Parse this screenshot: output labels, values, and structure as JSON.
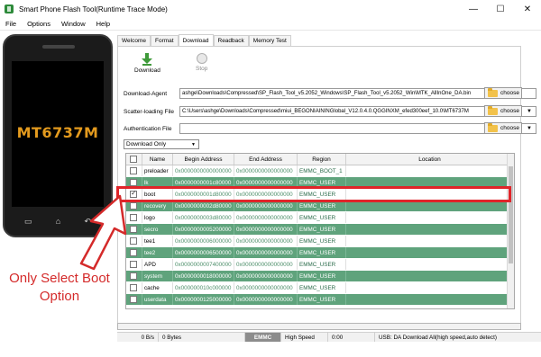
{
  "window": {
    "title": "Smart Phone Flash Tool(Runtime Trace Mode)",
    "minimize": "—",
    "maximize": "☐",
    "close": "✕"
  },
  "menu": [
    "File",
    "Options",
    "Window",
    "Help"
  ],
  "phone": {
    "model": "MT6737M"
  },
  "annotation": {
    "line1": "Only Select Boot",
    "line2": "Option",
    "color": "#d42a2a"
  },
  "tabs": [
    "Welcome",
    "Format",
    "Download",
    "Readback",
    "Memory Test"
  ],
  "active_tab": "Download",
  "toolbar": {
    "download_label": "Download",
    "stop_label": "Stop"
  },
  "fields": {
    "download_agent": {
      "label": "Download-Agent",
      "value": "ashge\\Downloads\\Compressed\\SP_Flash_Tool_v5.2052_Windows\\SP_Flash_Tool_v5.2052_Win\\MTK_AllInOne_DA.bin"
    },
    "scatter": {
      "label": "Scatter-loading File",
      "value": "C:\\Users\\ashge\\Downloads\\Compressed\\miui_BEGONIAININGlobal_V12.0.4.0.QGGINXM_efed300eef_10.0\\MT6737M"
    },
    "auth": {
      "label": "Authentication File",
      "value": ""
    },
    "choose_label": "choose"
  },
  "mode": {
    "selected": "Download Only"
  },
  "table": {
    "headers": [
      "Name",
      "Begin Address",
      "End Address",
      "Region",
      "Location"
    ],
    "rows": [
      {
        "name": "preloader",
        "begin": "0x0000000000000000",
        "end": "0x0000000000000000",
        "region": "EMMC_BOOT_1",
        "location": "",
        "checked": false,
        "style": "white"
      },
      {
        "name": "lk",
        "begin": "0x0000000001c80000",
        "end": "0x0000000000000000",
        "region": "EMMC_USER",
        "location": "",
        "checked": false,
        "style": "green"
      },
      {
        "name": "boot",
        "begin": "0x0000000001d80000",
        "end": "0x0000000000000000",
        "region": "EMMC_USER",
        "location": "",
        "checked": true,
        "style": "white"
      },
      {
        "name": "recovery",
        "begin": "0x0000000002d80000",
        "end": "0x0000000000000000",
        "region": "EMMC_USER",
        "location": "",
        "checked": false,
        "style": "green"
      },
      {
        "name": "logo",
        "begin": "0x0000000003d80000",
        "end": "0x0000000000000000",
        "region": "EMMC_USER",
        "location": "",
        "checked": false,
        "style": "white"
      },
      {
        "name": "secro",
        "begin": "0x0000000005200000",
        "end": "0x0000000000000000",
        "region": "EMMC_USER",
        "location": "",
        "checked": false,
        "style": "green"
      },
      {
        "name": "tee1",
        "begin": "0x0000000006000000",
        "end": "0x0000000000000000",
        "region": "EMMC_USER",
        "location": "",
        "checked": false,
        "style": "white"
      },
      {
        "name": "tee2",
        "begin": "0x0000000006500000",
        "end": "0x0000000000000000",
        "region": "EMMC_USER",
        "location": "",
        "checked": false,
        "style": "green"
      },
      {
        "name": "APD",
        "begin": "0x0000000007400000",
        "end": "0x0000000000000000",
        "region": "EMMC_USER",
        "location": "",
        "checked": false,
        "style": "white"
      },
      {
        "name": "system",
        "begin": "0x0000000018000000",
        "end": "0x0000000000000000",
        "region": "EMMC_USER",
        "location": "",
        "checked": false,
        "style": "green"
      },
      {
        "name": "cache",
        "begin": "0x000000010c000000",
        "end": "0x0000000000000000",
        "region": "EMMC_USER",
        "location": "",
        "checked": false,
        "style": "white"
      },
      {
        "name": "userdata",
        "begin": "0x0000000125000000",
        "end": "0x0000000000000000",
        "region": "EMMC_USER",
        "location": "",
        "checked": false,
        "style": "green"
      }
    ]
  },
  "status": {
    "speed": "0 B/s",
    "bytes": "0 Bytes",
    "storage": "EMMC",
    "mode": "High Speed",
    "time": "0:00",
    "info": "USB: DA Download All(high speed,auto detect)"
  }
}
